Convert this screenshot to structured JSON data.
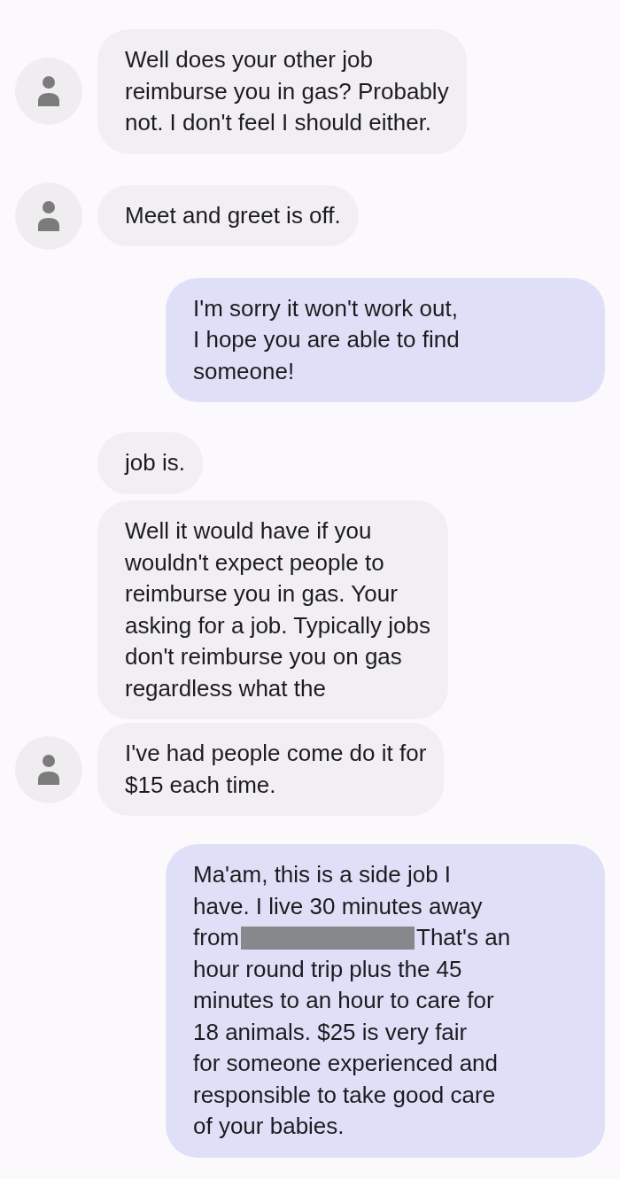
{
  "messages": [
    {
      "kind": "received",
      "avatar": true,
      "text": "Well does your other job\nreimburse you in gas? Probably\nnot. I don't feel I should either."
    },
    {
      "kind": "received",
      "avatar": true,
      "text": "Meet and greet is off."
    },
    {
      "kind": "sent",
      "text": "I'm sorry it won't work out,\nI hope you are able to find\nsomeone!"
    },
    {
      "kind": "received",
      "avatar": false,
      "text": "job is."
    },
    {
      "kind": "received",
      "avatar": false,
      "text": "Well it would have if you\nwouldn't expect people to\nreimburse you in gas. Your\nasking for a job. Typically jobs\ndon't reimburse you on gas\nregardless what the"
    },
    {
      "kind": "received",
      "avatar": true,
      "text": "I've had people come do it for\n$15 each time."
    },
    {
      "kind": "sent",
      "text": "Ma'am, this is a side job I\nhave. I live 30 minutes away",
      "line_start": "from",
      "redacted": true,
      "line_end": "That's an",
      "text_after": "hour round trip plus the 45\nminutes to an hour to care for\n18 animals. $25 is very fair\nfor someone experienced and\nresponsible to take good care\nof your babies."
    }
  ]
}
